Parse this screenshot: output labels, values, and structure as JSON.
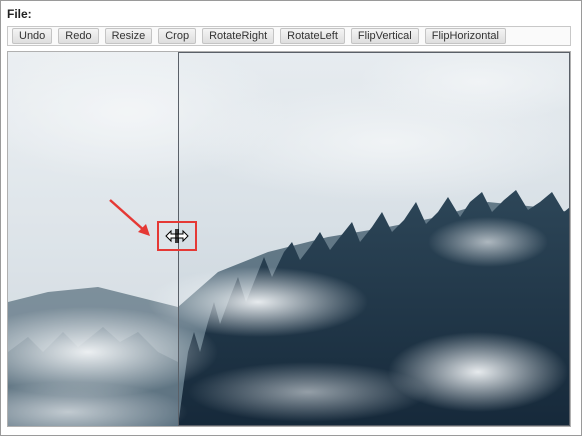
{
  "file_label": "File:",
  "toolbar": {
    "buttons": [
      "Undo",
      "Redo",
      "Resize",
      "Crop",
      "RotateRight",
      "RotateLeft",
      "FlipVertical",
      "FlipHorizontal"
    ]
  },
  "colors": {
    "annotation_red": "#e53935"
  },
  "icons": {
    "resize_cursor": "horizontal-resize-cursor-icon",
    "annotation_arrow": "arrow-icon"
  }
}
